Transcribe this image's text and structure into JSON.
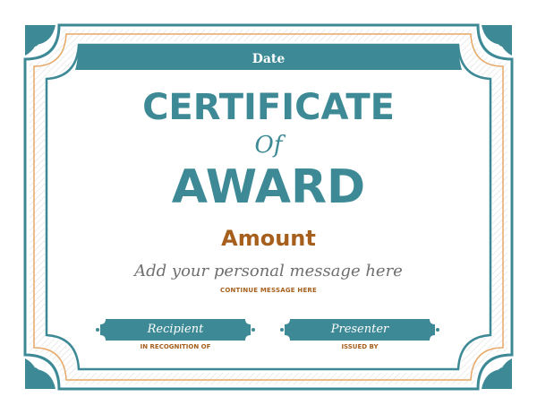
{
  "certificate": {
    "date": "Date",
    "title_line1": "CERTIFICATE",
    "title_line2": "Of",
    "title_line3": "AWARD",
    "amount": "Amount",
    "message": "Add your personal message here",
    "continue_message": "CONTINUE MESSAGE HERE",
    "recipient": "Recipient",
    "recognition_caption": "IN RECOGNITION OF",
    "presenter": "Presenter",
    "issued_caption": "ISSUED BY"
  },
  "colors": {
    "teal": "#3d8a96",
    "orange": "#a65f1c",
    "trim_orange": "#e6a866",
    "message_gray": "#6f6f6f"
  },
  "icons": [
    "corner-flourish-icon"
  ]
}
